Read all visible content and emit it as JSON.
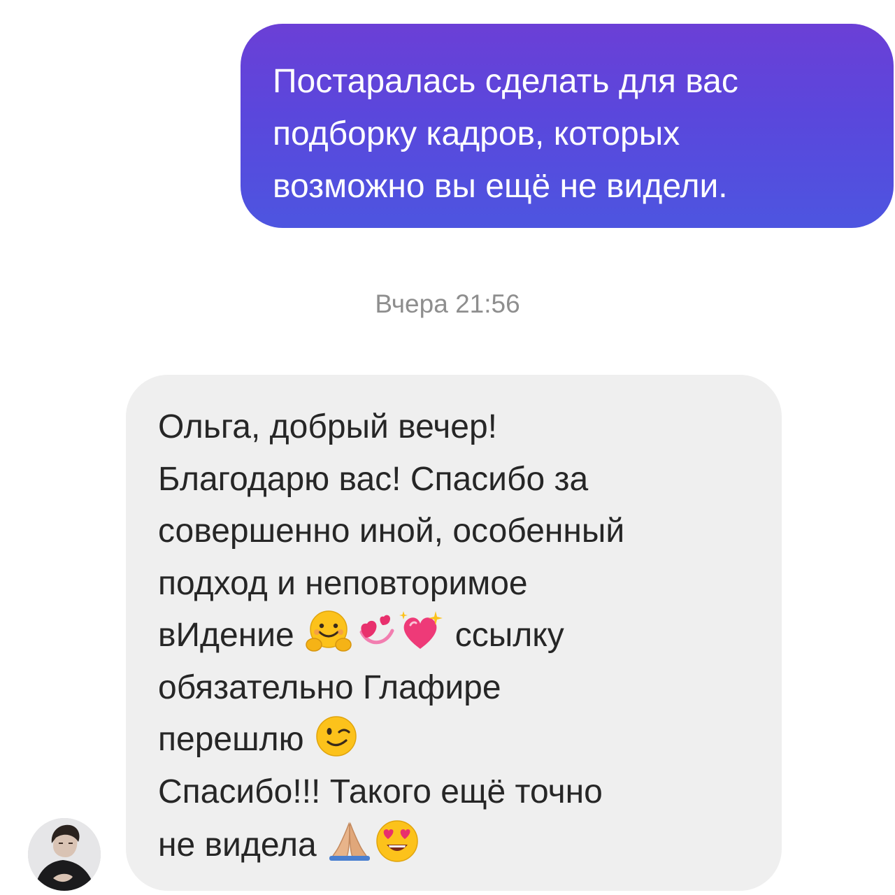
{
  "outgoing_message": {
    "lines": [
      "Постаралась сделать для вас",
      "подборку кадров, которых",
      "возможно вы ещё не видели."
    ],
    "gradient_top": "#6b3fd6",
    "gradient_bottom": "#4d55e0"
  },
  "timestamp": "Вчера 21:56",
  "incoming_message": {
    "lines": [
      "Ольга, добрый вечер!",
      "Благодарю вас! Спасибо за",
      "совершенно иной, особенный",
      "подход и неповторимое",
      "вИдение",
      "ссылку",
      "обязательно Глафире",
      "перешлю",
      "Спасибо!!! Такого ещё точно",
      "не видела"
    ],
    "emojis": {
      "line5": [
        "hugging-face-icon",
        "revolving-hearts-icon",
        "sparkling-heart-icon"
      ],
      "line8": [
        "winking-face-icon"
      ],
      "line10": [
        "folded-hands-icon",
        "heart-eyes-face-icon"
      ]
    },
    "background": "#efefef",
    "text_color": "#262626"
  },
  "sender_avatar": "avatar-photo"
}
